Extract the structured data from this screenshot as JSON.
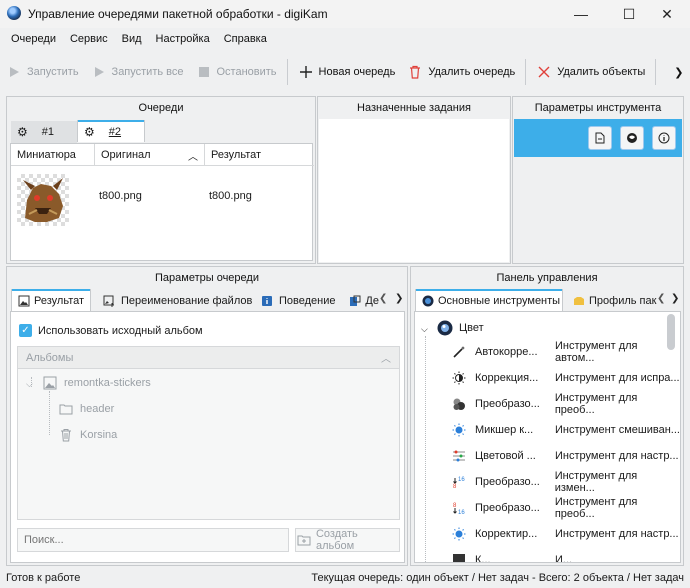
{
  "window": {
    "title": "Управление очередями пакетной обработки - digiKam",
    "minimize": "—",
    "maximize": "☐",
    "close": "✕"
  },
  "menu": [
    "Очереди",
    "Сервис",
    "Вид",
    "Настройка",
    "Справка"
  ],
  "toolbar": {
    "run": "Запустить",
    "run_all": "Запустить все",
    "stop": "Остановить",
    "new_queue": "Новая очередь",
    "delete_queue": "Удалить очередь",
    "remove_items": "Удалить объекты",
    "more": "❯"
  },
  "queues_panel": {
    "title": "Очереди",
    "tabs": [
      "#1",
      "#2"
    ],
    "columns": [
      "Миниатюра",
      "Оригинал",
      "Результат"
    ],
    "rows": [
      {
        "original": "t800.png",
        "result": "t800.png"
      }
    ]
  },
  "assigned_panel": {
    "title": "Назначенные задания"
  },
  "tool_params_panel": {
    "title": "Параметры инструмента"
  },
  "queue_settings": {
    "title": "Параметры очереди",
    "tabs": [
      "Результат",
      "Переименование файлов",
      "Поведение",
      "Де"
    ],
    "use_source_album": "Использовать исходный альбом",
    "albums_header": "Альбомы",
    "tree": {
      "root": "remontka-stickers",
      "children": [
        "header",
        "Korsina"
      ]
    },
    "search_placeholder": "Поиск...",
    "create_album": "Создать альбом"
  },
  "control_panel": {
    "title": "Панель управления",
    "tabs": [
      "Основные инструменты",
      "Профиль пак"
    ],
    "category": "Цвет",
    "tools": [
      {
        "name": "Автокорре...",
        "desc": "Инструмент для автом..."
      },
      {
        "name": "Коррекция...",
        "desc": "Инструмент для испра..."
      },
      {
        "name": "Преобразо...",
        "desc": "Инструмент для преоб..."
      },
      {
        "name": "Микшер к...",
        "desc": "Инструмент смешиван..."
      },
      {
        "name": "Цветовой ...",
        "desc": "Инструмент для настр..."
      },
      {
        "name": "Преобразо...",
        "desc": "Инструмент для измен..."
      },
      {
        "name": "Преобразо...",
        "desc": "Инструмент для преоб..."
      },
      {
        "name": "Корректир...",
        "desc": "Инструмент для настр..."
      },
      {
        "name": "К...",
        "desc": "И..."
      }
    ]
  },
  "status": {
    "left": "Готов к работе",
    "right": "Текущая очередь: один объект / Нет задач - Всего: 2 объекта / Нет задач"
  }
}
